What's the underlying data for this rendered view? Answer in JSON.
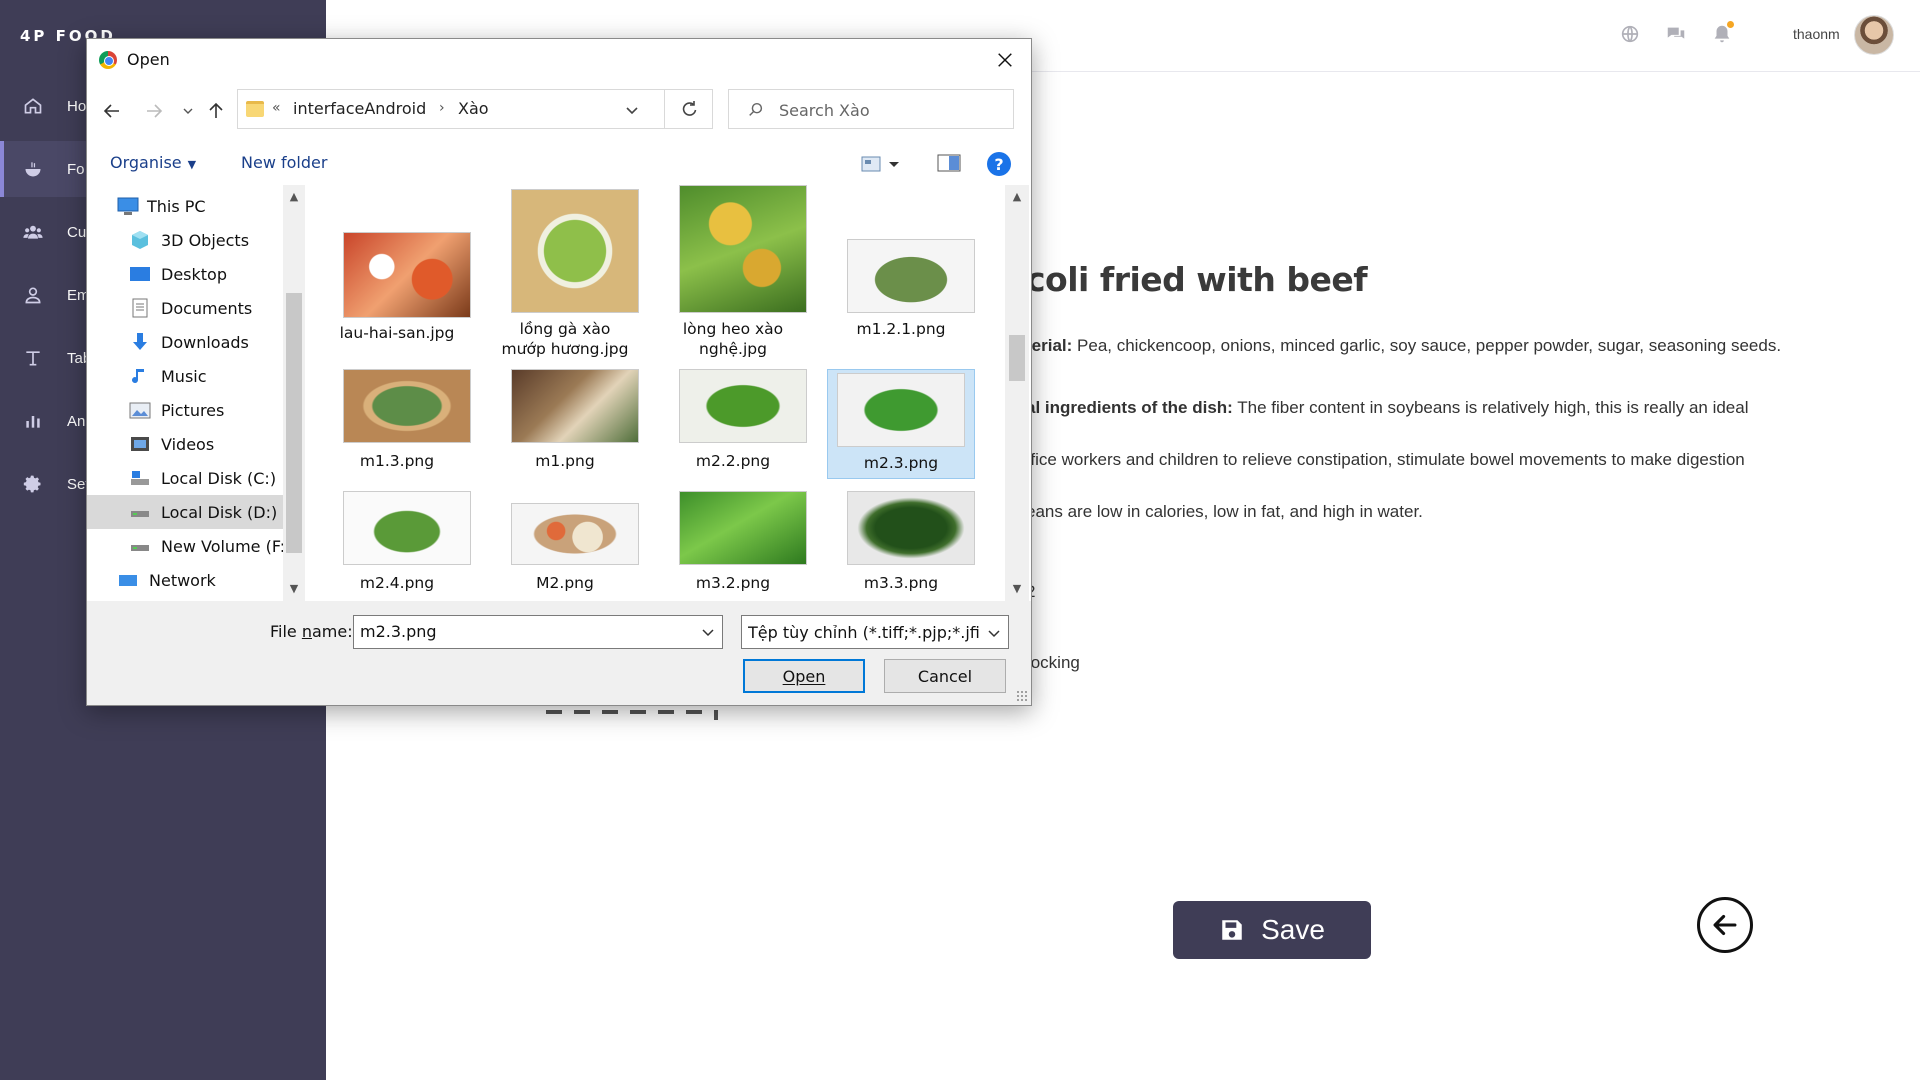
{
  "app": {
    "brand": "4P FOOD",
    "sidebar": {
      "items": [
        {
          "label": "Ho",
          "icon": "home-icon",
          "active": false
        },
        {
          "label": "Fo",
          "icon": "food-bowl-icon",
          "active": true
        },
        {
          "label": "Cu",
          "icon": "customers-icon",
          "active": false
        },
        {
          "label": "Em",
          "icon": "employee-icon",
          "active": false
        },
        {
          "label": "Tab",
          "icon": "table-icon",
          "active": false
        },
        {
          "label": "Ana",
          "icon": "analytics-icon",
          "active": false
        },
        {
          "label": "Set",
          "icon": "settings-icon",
          "active": false
        }
      ]
    },
    "topbar": {
      "username": "thaonm",
      "icons": [
        "globe-icon",
        "chat-icon",
        "bell-icon"
      ]
    },
    "content": {
      "title": "coli fried with beef",
      "material_label": "terial:",
      "material_text": " Pea, chickencoop, onions, minced garlic, soy sauce, pepper powder, sugar, seasoning seeds.",
      "nutrition_label": "al ingredients of the dish:",
      "nutrition_text": " The fiber content in soybeans is relatively high, this is really an ideal",
      "line3": "ffice workers and children to relieve constipation, stimulate bowel movements to make digestion",
      "line4": "eans are low in calories, low in fat, and high in water.",
      "line5": "2",
      "line6": "tocking"
    },
    "save_label": "Save"
  },
  "dialog": {
    "title": "Open",
    "breadcrumb": {
      "lead": "«",
      "folder1": "interfaceAndroid",
      "separator": "›",
      "folder2": "Xào"
    },
    "search_placeholder": "Search Xào",
    "organise_label": "Organise",
    "new_folder_label": "New folder",
    "tree": [
      {
        "label": "This PC",
        "icon": "pc-icon",
        "indent": 0
      },
      {
        "label": "3D Objects",
        "icon": "3d-objects-icon",
        "indent": 1
      },
      {
        "label": "Desktop",
        "icon": "desktop-icon",
        "indent": 1
      },
      {
        "label": "Documents",
        "icon": "documents-icon",
        "indent": 1
      },
      {
        "label": "Downloads",
        "icon": "downloads-icon",
        "indent": 1
      },
      {
        "label": "Music",
        "icon": "music-icon",
        "indent": 1
      },
      {
        "label": "Pictures",
        "icon": "pictures-icon",
        "indent": 1
      },
      {
        "label": "Videos",
        "icon": "videos-icon",
        "indent": 1
      },
      {
        "label": "Local Disk (C:)",
        "icon": "drive-c-icon",
        "indent": 1
      },
      {
        "label": "Local Disk (D:)",
        "icon": "drive-d-icon",
        "indent": 1,
        "selected": true
      },
      {
        "label": "New Volume (F:)",
        "icon": "drive-f-icon",
        "indent": 1
      },
      {
        "label": "Network",
        "icon": "network-icon",
        "indent": 0
      }
    ],
    "files": [
      {
        "name": "lau-hai-san.jpg",
        "line2": "",
        "selected": false
      },
      {
        "name": "lồng gà xào",
        "line2": "mướp hương.jpg",
        "selected": false
      },
      {
        "name": "lòng heo xào",
        "line2": "nghệ.jpg",
        "selected": false
      },
      {
        "name": "m1.2.1.png",
        "line2": "",
        "selected": false
      },
      {
        "name": "m1.3.png",
        "line2": "",
        "selected": false
      },
      {
        "name": "m1.png",
        "line2": "",
        "selected": false
      },
      {
        "name": "m2.2.png",
        "line2": "",
        "selected": false
      },
      {
        "name": "m2.3.png",
        "line2": "",
        "selected": true
      },
      {
        "name": "m2.4.png",
        "line2": "",
        "selected": false
      },
      {
        "name": "M2.png",
        "line2": "",
        "selected": false
      },
      {
        "name": "m3.2.png",
        "line2": "",
        "selected": false
      },
      {
        "name": "m3.3.png",
        "line2": "",
        "selected": false
      }
    ],
    "file_name_label_pre": "File ",
    "file_name_label_u": "n",
    "file_name_label_post": "ame:",
    "file_name_value": "m2.3.png",
    "file_type": "Tệp tùy chỉnh (*.tiff;*.pjp;*.jfif;*",
    "open_label": "Open",
    "cancel_label": "Cancel"
  }
}
